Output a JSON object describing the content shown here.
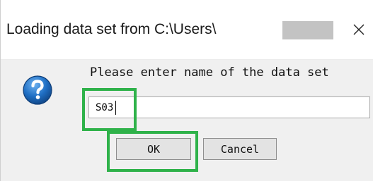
{
  "window": {
    "title": "Loading data set from C:\\Users\\"
  },
  "dialog": {
    "prompt": "Please enter name of the data set",
    "input_value": "S03",
    "ok_label": "OK",
    "cancel_label": "Cancel"
  },
  "icons": {
    "dialog": "question-icon",
    "close": "close-icon"
  },
  "colors": {
    "highlight": "#2fb24a",
    "question_icon": "#1f6fc4"
  }
}
